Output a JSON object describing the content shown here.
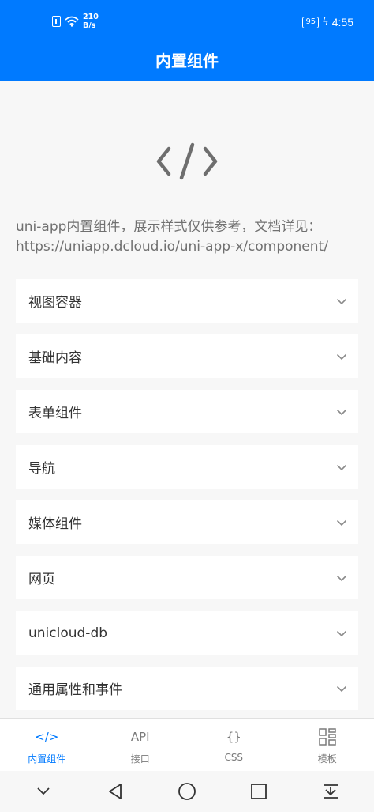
{
  "status_bar": {
    "network_speed_value": "210",
    "network_speed_unit": "B/s",
    "battery_level": "95",
    "time": "4:55"
  },
  "header": {
    "title": "内置组件"
  },
  "hero": {
    "icon": "code-brackets-icon"
  },
  "intro": {
    "line1": "uni-app内置组件，展示样式仅供参考，文档详见：",
    "line2": "https://uniapp.dcloud.io/uni-app-x/component/"
  },
  "list": {
    "items": [
      {
        "label": "视图容器"
      },
      {
        "label": "基础内容"
      },
      {
        "label": "表单组件"
      },
      {
        "label": "导航"
      },
      {
        "label": "媒体组件"
      },
      {
        "label": "网页"
      },
      {
        "label": "unicloud-db"
      },
      {
        "label": "通用属性和事件"
      }
    ]
  },
  "tabbar": {
    "tabs": [
      {
        "label": "内置组件",
        "icon_text": "</>",
        "icon": "code-icon",
        "active": true
      },
      {
        "label": "接口",
        "icon_text": "API",
        "icon": "api-icon",
        "active": false
      },
      {
        "label": "CSS",
        "icon_text": "{}",
        "icon": "braces-icon",
        "active": false
      },
      {
        "label": "模板",
        "icon_text": "",
        "icon": "template-grid-icon",
        "active": false
      }
    ]
  },
  "colors": {
    "accent": "#007aff",
    "background": "#f7f7f7",
    "card": "#ffffff",
    "muted_text": "#707070"
  }
}
